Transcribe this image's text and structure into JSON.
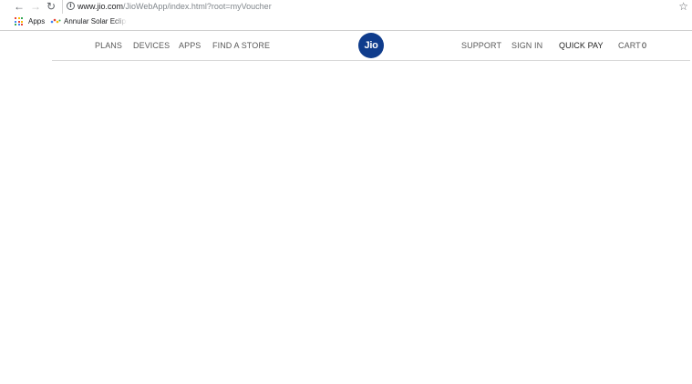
{
  "browser": {
    "url_host": "www.jio.com",
    "url_path": "/JioWebApp/index.html?root=myVoucher",
    "bookmarks": [
      {
        "label": "Apps"
      },
      {
        "label": "Annular Solar Eclipse"
      }
    ]
  },
  "site": {
    "logo_text": "Jio",
    "nav_left": [
      "PLANS",
      "DEVICES",
      "APPS",
      "FIND A STORE"
    ],
    "nav_right": {
      "support": "SUPPORT",
      "sign_in": "SIGN IN",
      "quick_pay": "QUICK PAY",
      "cart": "CART",
      "cart_count": "0"
    },
    "brand_color": "#0f3c8c"
  }
}
